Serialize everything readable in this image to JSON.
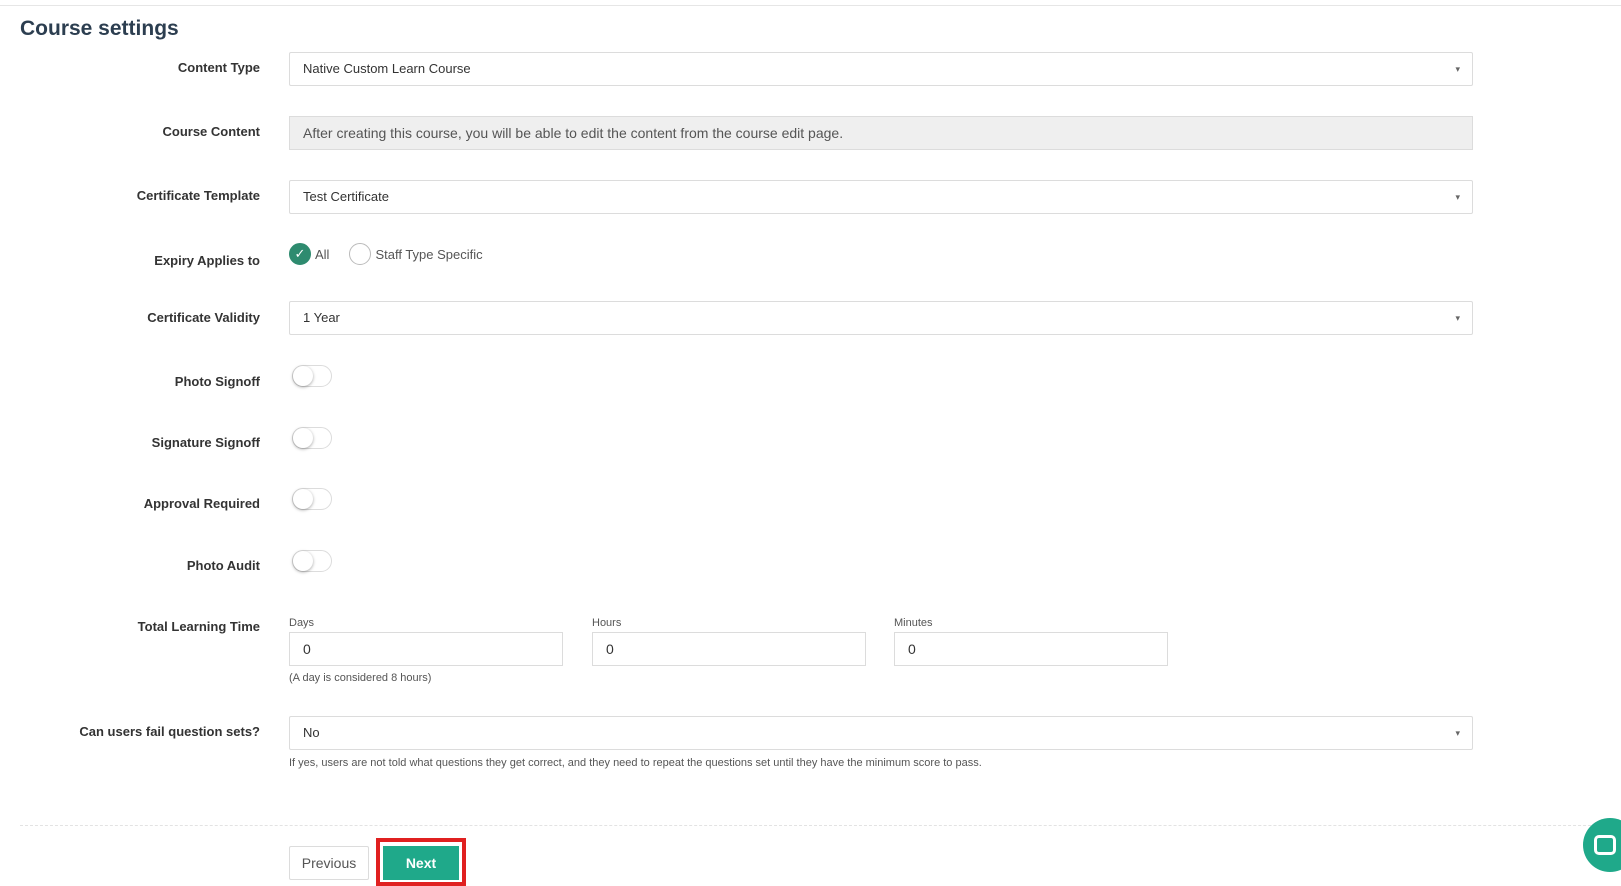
{
  "page": {
    "title": "Course settings"
  },
  "content_type": {
    "label": "Content Type",
    "value": "Native Custom Learn Course"
  },
  "course_content": {
    "label": "Course Content",
    "value": "After creating this course, you will be able to edit the content from the course edit page."
  },
  "certificate_template": {
    "label": "Certificate Template",
    "value": "Test Certificate"
  },
  "expiry": {
    "label": "Expiry Applies to",
    "options": [
      {
        "label": "All",
        "checked": true
      },
      {
        "label": "Staff Type Specific",
        "checked": false
      }
    ]
  },
  "certificate_validity": {
    "label": "Certificate Validity",
    "value": "1 Year"
  },
  "toggles": {
    "photo_signoff": {
      "label": "Photo Signoff",
      "on": false
    },
    "signature_signoff": {
      "label": "Signature Signoff",
      "on": false
    },
    "approval_required": {
      "label": "Approval Required",
      "on": false
    },
    "photo_audit": {
      "label": "Photo Audit",
      "on": false
    }
  },
  "learning_time": {
    "label": "Total Learning Time",
    "days": {
      "label": "Days",
      "value": "0"
    },
    "hours": {
      "label": "Hours",
      "value": "0"
    },
    "minutes": {
      "label": "Minutes",
      "value": "0"
    },
    "help": "(A day is considered 8 hours)"
  },
  "fail_questions": {
    "label": "Can users fail question sets?",
    "value": "No",
    "help": "If yes, users are not told what questions they get correct, and they need to repeat the questions set until they have the minimum score to pass."
  },
  "actions": {
    "previous_label": "Previous",
    "next_label": "Next"
  },
  "icons": {
    "caret": "▾",
    "check": "✓"
  },
  "colors": {
    "accent": "#1fa98a",
    "checked": "#2e8b6f",
    "highlight": "#e02020"
  }
}
